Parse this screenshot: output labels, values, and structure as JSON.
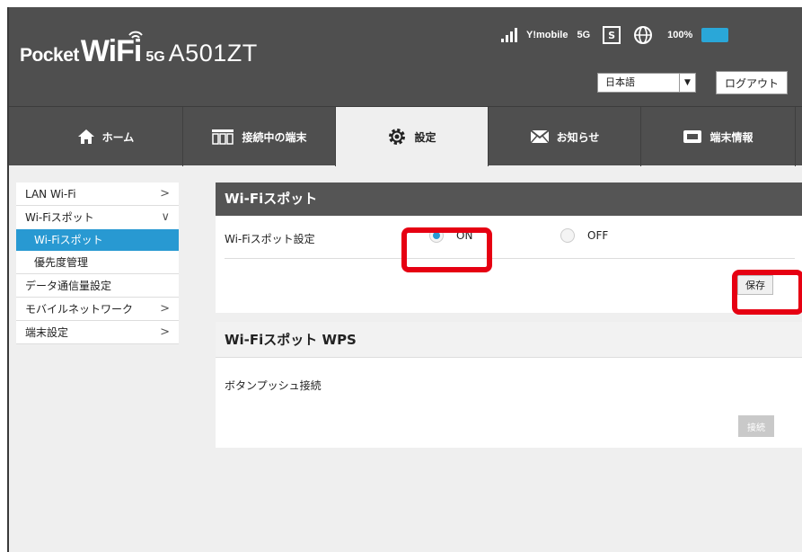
{
  "header": {
    "logo_pocket": "Pocket",
    "logo_wifi": "WiFi",
    "logo_5g": "5G",
    "logo_model": "A501ZT",
    "carrier": "Y!mobile",
    "network": "5G",
    "sim_badge": "S",
    "battery_pct": "100%",
    "battery_level": 1.0,
    "battery_color": "#2aa7d8",
    "language_value": "日本語",
    "logout_label": "ログアウト"
  },
  "tabs": [
    {
      "label": "ホーム",
      "icon": "home-icon"
    },
    {
      "label": "接続中の端末",
      "icon": "devices-icon"
    },
    {
      "label": "設定",
      "icon": "gear-icon",
      "active": true
    },
    {
      "label": "お知らせ",
      "icon": "mail-icon"
    },
    {
      "label": "端末情報",
      "icon": "device-info-icon"
    }
  ],
  "sidebar": {
    "items": [
      {
        "label": "LAN Wi-Fi"
      },
      {
        "label": "Wi-Fiスポット"
      },
      {
        "label": "Wi-Fiスポット"
      },
      {
        "label": "優先度管理"
      },
      {
        "label": "データ通信量設定"
      },
      {
        "label": "モバイルネットワーク"
      },
      {
        "label": "端末設定"
      }
    ]
  },
  "main": {
    "section_title": "Wi-Fiスポット",
    "setting_label": "Wi-Fiスポット設定",
    "option_on": "ON",
    "option_off": "OFF",
    "selected": "ON",
    "save_label": "保存",
    "wps_title": "Wi-Fiスポット WPS",
    "wps_label": "ボタンプッシュ接続",
    "connect_label": "接続"
  },
  "colors": {
    "accent": "#2899d2",
    "highlight": "#e60012",
    "header_bg": "#4f4f4f"
  }
}
